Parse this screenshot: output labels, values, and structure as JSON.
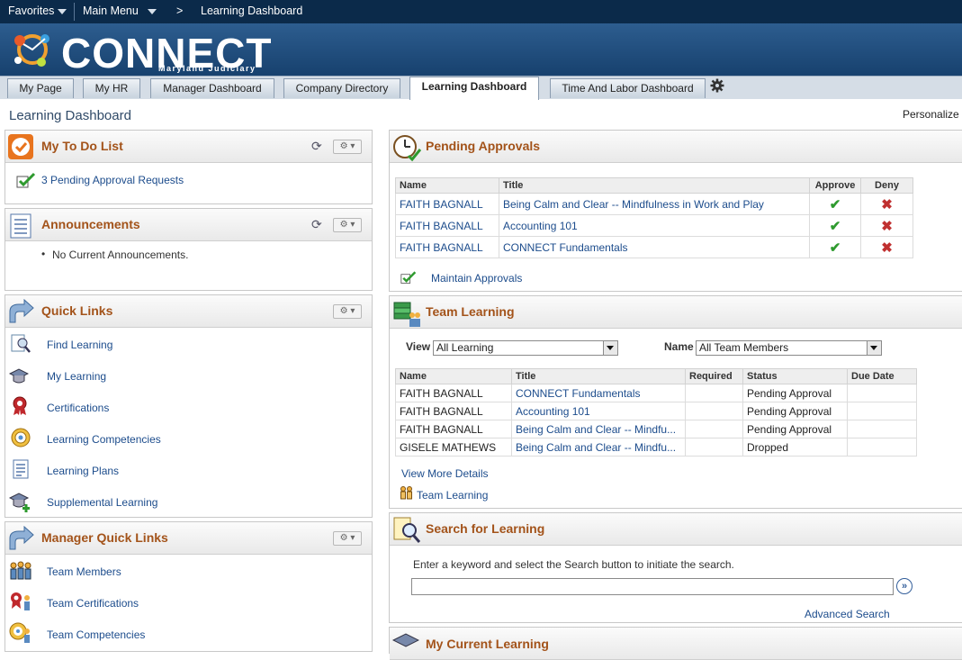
{
  "topbar": {
    "favorites": "Favorites",
    "main_menu": "Main Menu",
    "separator": ">",
    "breadcrumb": "Learning Dashboard"
  },
  "brand": {
    "name": "CONNECT",
    "sub": "Maryland Judiciary"
  },
  "tabs": [
    {
      "label": "My Page"
    },
    {
      "label": "My HR"
    },
    {
      "label": "Manager Dashboard"
    },
    {
      "label": "Company Directory"
    },
    {
      "label": "Learning Dashboard",
      "active": true
    },
    {
      "label": "Time And Labor Dashboard"
    }
  ],
  "page": {
    "title": "Learning Dashboard",
    "personalize": "Personalize"
  },
  "todo": {
    "title": "My To Do List",
    "item": "3 Pending Approval Requests"
  },
  "announcements": {
    "title": "Announcements",
    "empty": "No Current Announcements."
  },
  "quick_links": {
    "title": "Quick Links",
    "items": [
      "Find Learning",
      "My Learning",
      "Certifications",
      "Learning Competencies",
      "Learning Plans",
      "Supplemental Learning"
    ]
  },
  "manager_links": {
    "title": "Manager Quick Links",
    "items": [
      "Team Members",
      "Team Certifications",
      "Team Competencies"
    ]
  },
  "pending": {
    "title": "Pending Approvals",
    "headers": {
      "name": "Name",
      "title": "Title",
      "approve": "Approve",
      "deny": "Deny"
    },
    "rows": [
      {
        "name": "FAITH BAGNALL",
        "title": "Being Calm and Clear -- Mindfulness in Work and Play"
      },
      {
        "name": "FAITH BAGNALL",
        "title": "Accounting 101"
      },
      {
        "name": "FAITH BAGNALL",
        "title": "CONNECT Fundamentals"
      }
    ],
    "maintain": "Maintain Approvals"
  },
  "team": {
    "title": "Team Learning",
    "view_label": "View",
    "view_value": "All Learning",
    "name_label": "Name",
    "name_value": "All Team Members",
    "headers": {
      "name": "Name",
      "title": "Title",
      "required": "Required",
      "status": "Status",
      "due": "Due Date"
    },
    "rows": [
      {
        "name": "FAITH BAGNALL",
        "title": "CONNECT Fundamentals",
        "required": "",
        "status": "Pending Approval",
        "due": ""
      },
      {
        "name": "FAITH BAGNALL",
        "title": "Accounting 101",
        "required": "",
        "status": "Pending Approval",
        "due": ""
      },
      {
        "name": "FAITH BAGNALL",
        "title": "Being Calm and Clear -- Mindfu...",
        "required": "",
        "status": "Pending Approval",
        "due": ""
      },
      {
        "name": "GISELE MATHEWS",
        "title": "Being Calm and Clear -- Mindfu...",
        "required": "",
        "status": "Dropped",
        "due": ""
      }
    ],
    "more": "View More Details",
    "link": "Team Learning"
  },
  "search": {
    "title": "Search for Learning",
    "hint": "Enter a keyword and select the Search button to initiate the search.",
    "value": "",
    "advanced": "Advanced Search"
  },
  "current": {
    "title": "My Current Learning"
  },
  "icons": {
    "check": "checkmark-icon",
    "deny": "x-icon",
    "gear": "gear-icon",
    "refresh": "refresh-icon"
  }
}
